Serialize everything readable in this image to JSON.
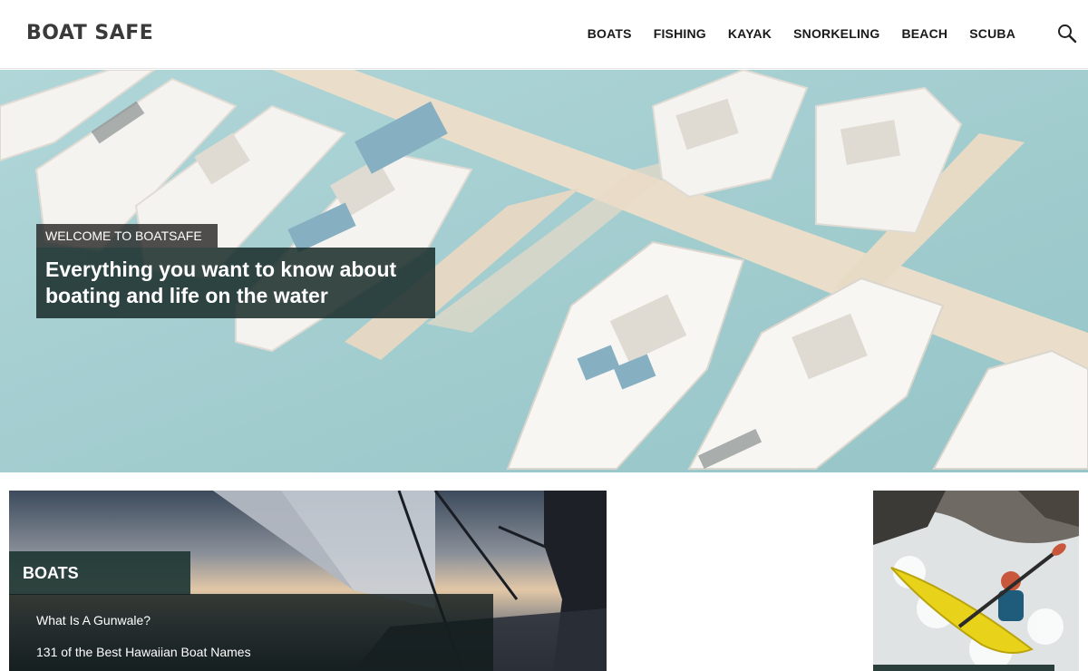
{
  "site": {
    "logo": "BOAT SAFE"
  },
  "nav": {
    "items": [
      "BOATS",
      "FISHING",
      "KAYAK",
      "SNORKELING",
      "BEACH",
      "SCUBA"
    ]
  },
  "hero": {
    "kicker": "WELCOME TO BOATSAFE",
    "title": "Everything you want to know about boating and life on the water"
  },
  "boats_card": {
    "tag": "BOATS",
    "links": [
      "What Is A Gunwale?",
      "131 of the Best Hawaiian Boat Names"
    ]
  },
  "icons": {
    "search": "search-icon"
  },
  "colors": {
    "overlay_dark_teal": "#1c302e",
    "hero_water": "#8fc3c6",
    "kayak_yellow": "#e8d21a"
  }
}
